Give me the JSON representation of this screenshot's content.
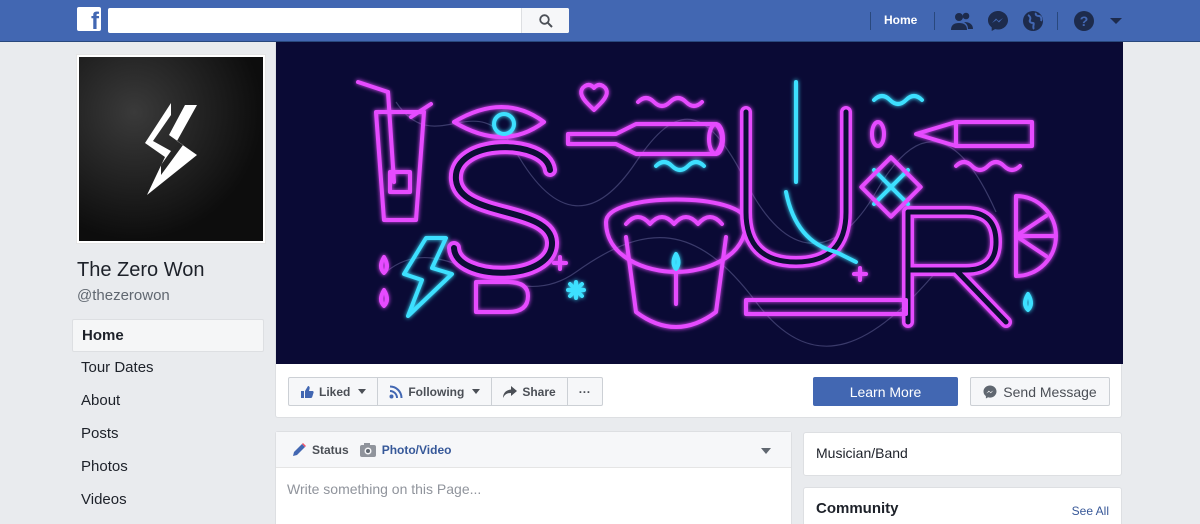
{
  "topbar": {
    "logo_letter": "f",
    "search": {
      "value": "",
      "placeholder": ""
    },
    "home_label": "Home"
  },
  "profile": {
    "name": "The Zero Won",
    "handle": "@thezerowon"
  },
  "leftnav": {
    "items": [
      {
        "label": "Home",
        "active": true
      },
      {
        "label": "Tour Dates"
      },
      {
        "label": "About"
      },
      {
        "label": "Posts"
      },
      {
        "label": "Photos"
      },
      {
        "label": "Videos"
      }
    ]
  },
  "actions": {
    "liked": "Liked",
    "following": "Following",
    "share": "Share",
    "more": "···",
    "learn_more": "Learn More",
    "send_message": "Send Message"
  },
  "composer": {
    "status_tab": "Status",
    "photo_tab": "Photo/Video",
    "placeholder": "Write something on this Page..."
  },
  "right": {
    "category": "Musician/Band",
    "community_title": "Community",
    "see_all": "See All"
  },
  "colors": {
    "brand": "#4267b2",
    "cover_bg": "#0a0a35",
    "neon_pink": "#e64cff",
    "neon_cyan": "#3de0ff"
  }
}
